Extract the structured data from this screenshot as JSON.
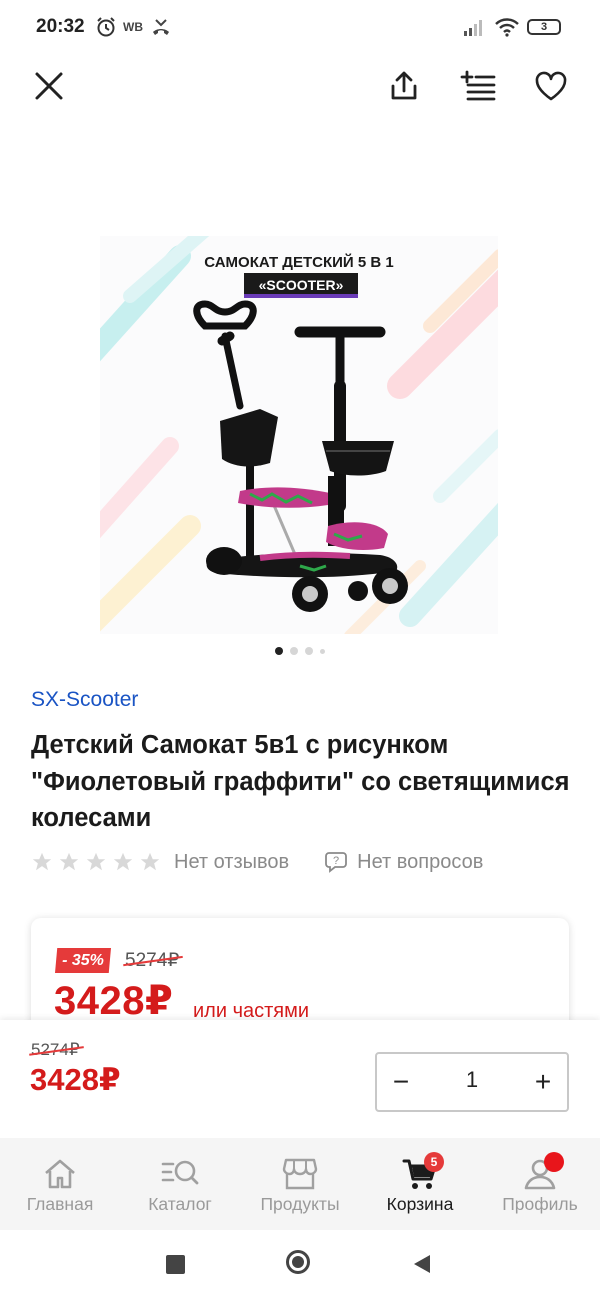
{
  "status_bar": {
    "time": "20:32",
    "wb": "WB",
    "battery": "3"
  },
  "top_bar": {
    "close_icon": "close-icon",
    "share_icon": "share-icon",
    "list_icon": "add-to-list-icon",
    "favorite_icon": "heart-icon"
  },
  "gallery": {
    "banner_line1": "САМОКАТ ДЕТСКИЙ 5 В 1",
    "banner_line2": "«SCOOTER»",
    "dots": 4,
    "active_dot": 0
  },
  "product": {
    "brand": "SX-Scooter",
    "title": "Детский Самокат 5в1 с рисунком \"Фиолетовый граффити\" со светящимися колесами",
    "rating_stars": 0,
    "reviews": "Нет отзывов",
    "questions": "Нет вопросов"
  },
  "price_card": {
    "discount": "- 35%",
    "old_price": "5274₽",
    "new_price": "3428₽",
    "installments": "или частями"
  },
  "sticky": {
    "old_price": "5274₽",
    "new_price": "3428₽",
    "minus": "−",
    "plus": "+",
    "quantity": "1"
  },
  "tabbar": {
    "tabs": [
      {
        "label": "Главная",
        "icon": "home-icon"
      },
      {
        "label": "Каталог",
        "icon": "catalog-search-icon"
      },
      {
        "label": "Продукты",
        "icon": "store-icon"
      },
      {
        "label": "Корзина",
        "icon": "cart-icon",
        "active": true
      },
      {
        "label": "Профиль",
        "icon": "profile-icon"
      }
    ],
    "cart_badge": "5"
  },
  "colors": {
    "accent_red": "#d41b1b",
    "brand_blue": "#1a54c4",
    "badge_red": "#e53a3a"
  }
}
